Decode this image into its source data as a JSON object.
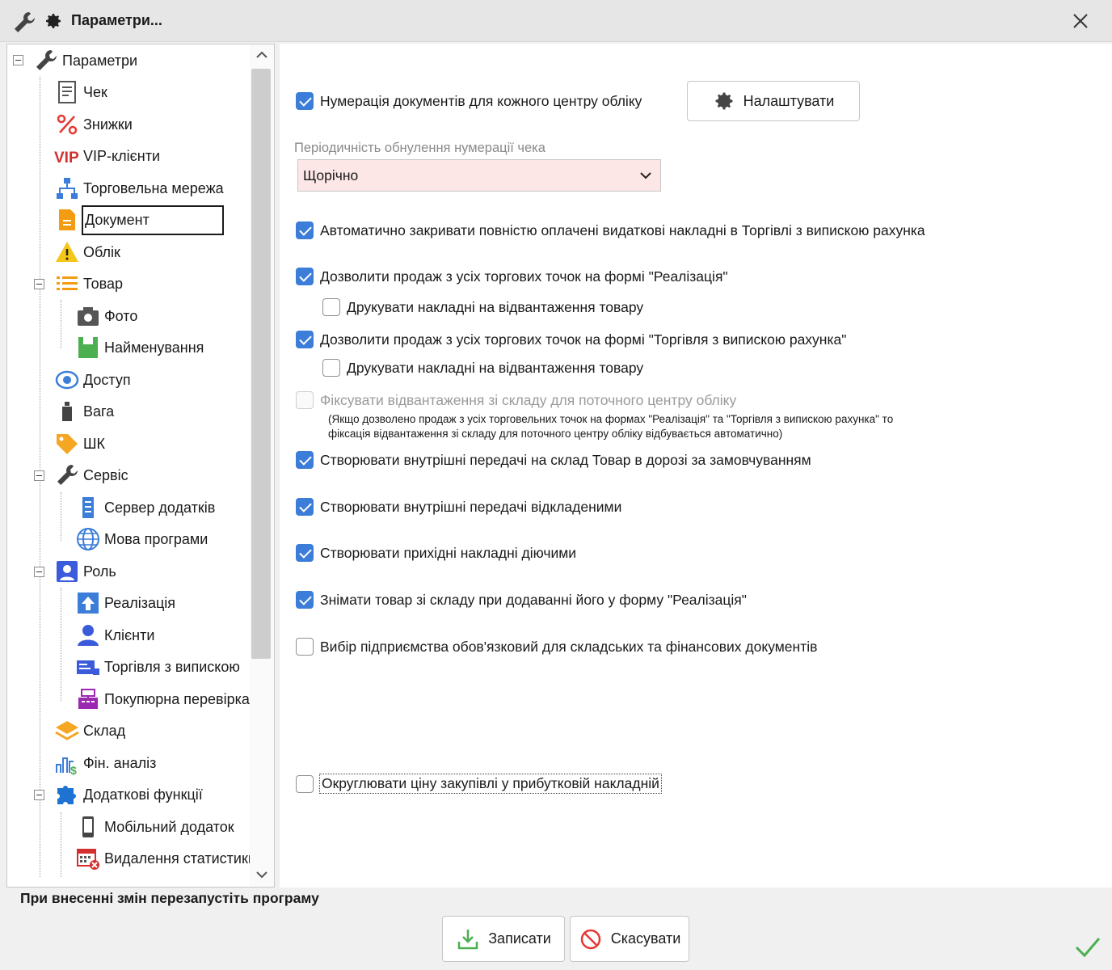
{
  "window": {
    "title": "Параметри..."
  },
  "tree": {
    "items": [
      {
        "label": "Параметри",
        "icon": "wrench-icon"
      },
      {
        "label": "Чек",
        "icon": "receipt-icon"
      },
      {
        "label": "Знижки",
        "icon": "percent-icon"
      },
      {
        "label": "VIP-клієнти",
        "icon": "vip-icon"
      },
      {
        "label": "Торговельна мережа",
        "icon": "network-icon"
      },
      {
        "label": "Документ",
        "icon": "document-icon"
      },
      {
        "label": "Облік",
        "icon": "warning-icon"
      },
      {
        "label": "Товар",
        "icon": "list-icon"
      },
      {
        "label": "Фото",
        "icon": "camera-icon"
      },
      {
        "label": "Найменування",
        "icon": "tag-green-icon"
      },
      {
        "label": "Доступ",
        "icon": "eye-icon"
      },
      {
        "label": "Вага",
        "icon": "scale-icon"
      },
      {
        "label": "ШК",
        "icon": "label-icon"
      },
      {
        "label": "Сервіс",
        "icon": "wrench-icon"
      },
      {
        "label": "Сервер додатків",
        "icon": "server-icon"
      },
      {
        "label": "Мова програми",
        "icon": "globe-icon"
      },
      {
        "label": "Роль",
        "icon": "person-card-icon"
      },
      {
        "label": "Реалізація",
        "icon": "upload-icon"
      },
      {
        "label": "Клієнти",
        "icon": "person-icon"
      },
      {
        "label": "Торгівля з випискою",
        "icon": "invoice-icon"
      },
      {
        "label": "Покупюрна перевірка",
        "icon": "cash-register-icon"
      },
      {
        "label": "Склад",
        "icon": "layers-icon"
      },
      {
        "label": "Фін. аналіз",
        "icon": "finance-icon"
      },
      {
        "label": "Додаткові функції",
        "icon": "puzzle-icon"
      },
      {
        "label": "Мобільний додаток",
        "icon": "phone-icon"
      },
      {
        "label": "Видалення статистики",
        "icon": "calendar-delete-icon"
      }
    ]
  },
  "content": {
    "numbering_checkbox": "Нумерація документів для кожного центру обліку",
    "setup_button": "Налаштувати",
    "reset_period_label": "Періодичність обнулення нумерації чека",
    "reset_period_value": "Щорічно",
    "options": [
      {
        "label": "Автоматично закривати повністю оплачені видаткові накладні в Торгівлі з випискою рахунка",
        "checked": true
      },
      {
        "label": "Дозволити продаж з усіх торгових точок на формі \"Реалізація\"",
        "checked": true
      },
      {
        "label": "Друкувати накладні на відвантаження товару",
        "checked": false
      },
      {
        "label": "Дозволити продаж з усіх торгових точок на формі \"Торгівля з випискою рахунка\"",
        "checked": true
      },
      {
        "label": "Друкувати накладні на відвантаження товару",
        "checked": false
      },
      {
        "label": "Фіксувати відвантаження зі складу для поточного центру обліку",
        "checked": false,
        "disabled": true
      },
      {
        "label": "Створювати внутрішні передачі на склад Товар в дорозі за замовчуванням",
        "checked": true
      },
      {
        "label": "Створювати внутрішні передачі відкладеними",
        "checked": true
      },
      {
        "label": "Створювати прихідні накладні діючими",
        "checked": true
      },
      {
        "label": "Знімати товар зі складу при додаванні його у форму \"Реалізація\"",
        "checked": true
      },
      {
        "label": "Вибір підприємства обов'язковий для складських та фінансових документів",
        "checked": false
      },
      {
        "label": "Округлювати ціну закупівлі у прибутковій накладній",
        "checked": false
      }
    ],
    "note_line1": "(Якщо дозволено продаж з усіх торговельних точок на формах \"Реалізація\" та \"Торгівля з випискою рахунка\" то",
    "note_line2": "фіксація відвантаження зі складу для поточного центру обліку відбувається автоматично)"
  },
  "footer": {
    "restart_text": "При внесенні змін перезапустіть програму",
    "save_label": "Записати",
    "cancel_label": "Скасувати"
  },
  "colors": {
    "accent": "#3b7dd8",
    "select_bg": "#fde6e6",
    "ok_green": "#4caf50"
  }
}
